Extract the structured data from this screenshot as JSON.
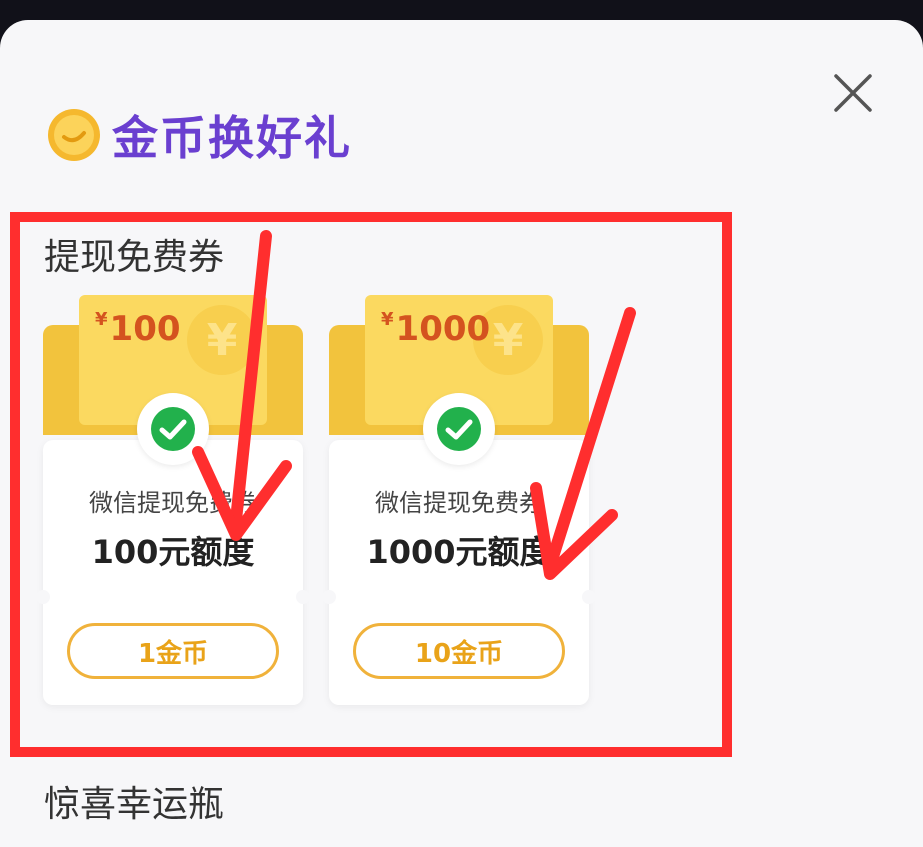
{
  "header": {
    "title": "金币换好礼",
    "icon": "coin-icon"
  },
  "close_icon": "close-icon",
  "sections": [
    {
      "title": "提现免费券",
      "cards": [
        {
          "amount": "100",
          "currency_symbol": "¥",
          "label": "微信提现免费券",
          "quota": "100元额度",
          "price": "1金币",
          "icon": "wechat-icon"
        },
        {
          "amount": "1000",
          "currency_symbol": "¥",
          "label": "微信提现免费券",
          "quota": "1000元额度",
          "price": "10金币",
          "icon": "wechat-icon"
        }
      ]
    },
    {
      "title": "惊喜幸运瓶"
    }
  ],
  "colors": {
    "accent_purple": "#6a3fd0",
    "highlight_red": "#ff2e2e",
    "ticket_yellow": "#fbd960",
    "price_orange": "#e9a319"
  }
}
